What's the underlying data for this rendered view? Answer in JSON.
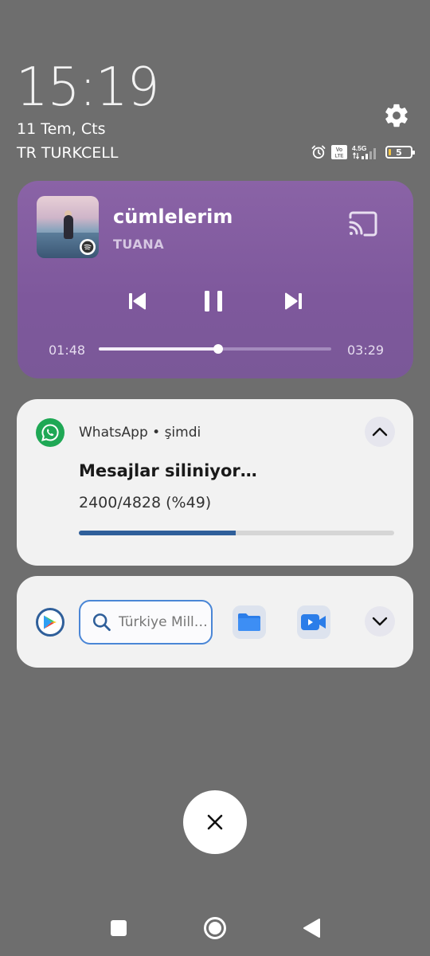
{
  "lockscreen": {
    "time": "15:19",
    "date": "11 Tem, Cts",
    "carrier": "TR TURKCELL",
    "settings_icon": "gear-icon",
    "status": {
      "network": "4.5G",
      "volte": "Vo LTE",
      "battery_level": "5",
      "icons": [
        "alarm-icon",
        "volte-icon",
        "signal-icon",
        "battery-icon"
      ]
    }
  },
  "media": {
    "title": "cümlelerim",
    "artist": "TUANA",
    "elapsed": "01:48",
    "duration": "03:29",
    "progress": 0.515,
    "background": "#8a63a6",
    "icons": [
      "album-art",
      "spotify-icon",
      "cast-icon",
      "previous-icon",
      "pause-icon",
      "next-icon"
    ]
  },
  "whatsapp": {
    "app_label": "WhatsApp • şimdi",
    "title": "Mesajlar siliniyor…",
    "subtitle": "2400/4828 (%49)",
    "progress": 0.497,
    "accent": "#1fa855",
    "bar_color": "#2f5f9a"
  },
  "search_widget": {
    "placeholder": "Türkiye Mill…",
    "icons": [
      "google-play-icon",
      "search-icon",
      "folder-icon",
      "video-icon",
      "chevron-down-icon"
    ]
  },
  "close_button_icon": "close-icon",
  "navbar": {
    "icons": [
      "recents-icon",
      "home-icon",
      "back-icon"
    ]
  }
}
